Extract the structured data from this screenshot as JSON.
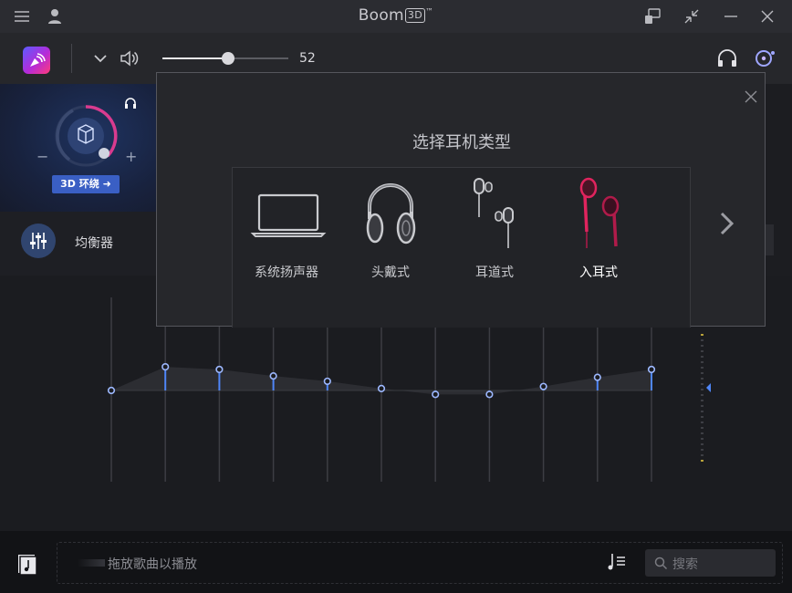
{
  "app": {
    "title": "Boom",
    "title_box": "3D",
    "title_tm": "™"
  },
  "toolbar": {
    "volume": 52,
    "volume_fraction": 0.52
  },
  "surround": {
    "button_label": "3D 环绕 ➜",
    "minus": "−",
    "plus": "+"
  },
  "equalizer": {
    "label": "均衡器",
    "bands": [
      0.0,
      0.36,
      0.32,
      0.22,
      0.14,
      0.03,
      -0.06,
      -0.06,
      0.06,
      0.2,
      0.32
    ]
  },
  "modal": {
    "title": "选择耳机类型",
    "items": [
      {
        "name": "系统扬声器",
        "icon": "laptop-icon",
        "selected": false
      },
      {
        "name": "头戴式",
        "icon": "over-ear-headphones-icon",
        "selected": false
      },
      {
        "name": "耳道式",
        "icon": "earbuds-icon",
        "selected": false
      },
      {
        "name": "入耳式",
        "icon": "in-ear-icon",
        "selected": true
      },
      {
        "name": "",
        "icon": "headphones-partial-icon",
        "selected": false
      }
    ]
  },
  "player": {
    "drop_text": "拖放歌曲以播放",
    "search_placeholder": "搜索"
  },
  "colors": {
    "accent": "#3a5fc4",
    "selected_headphone": "#e0245e",
    "eq_point": "#4f86f7"
  }
}
